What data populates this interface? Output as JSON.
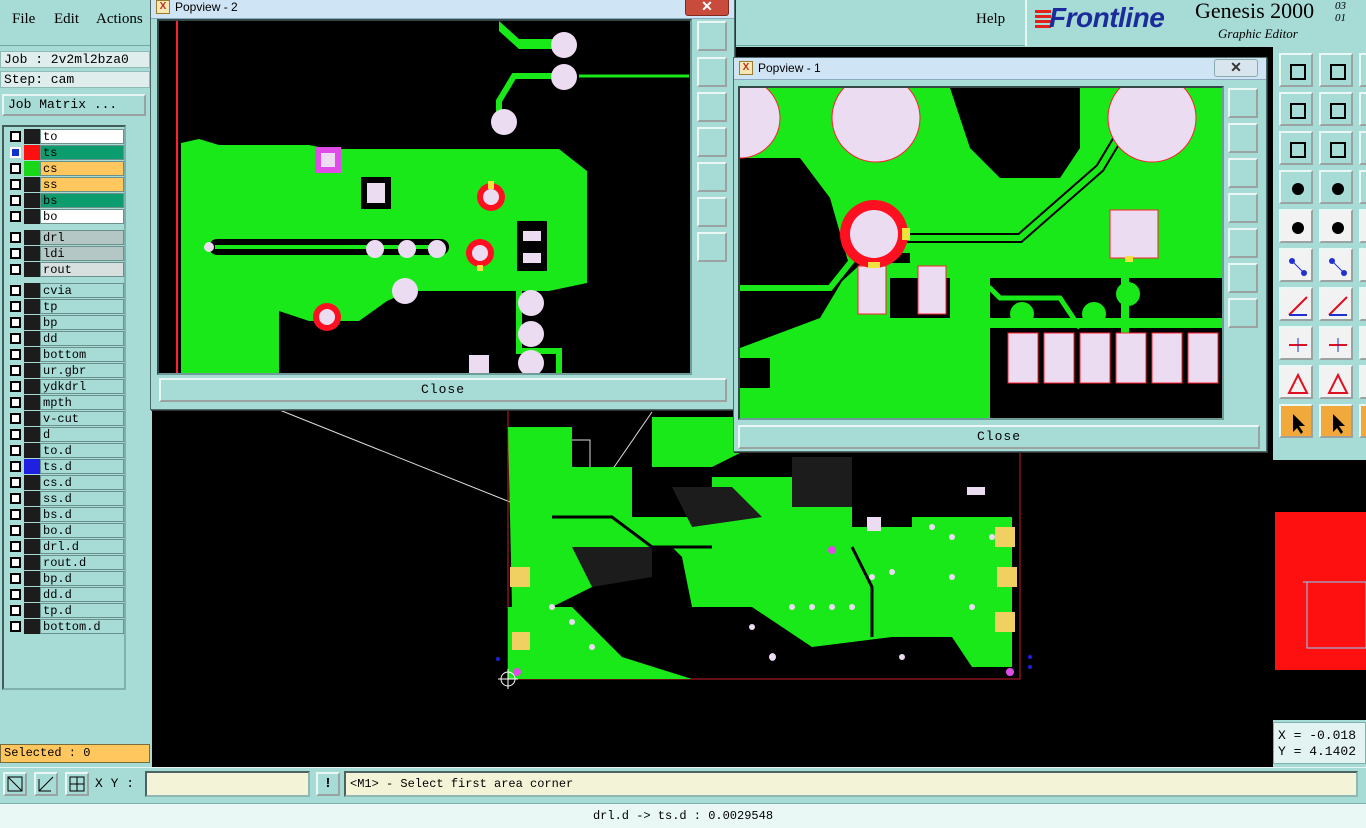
{
  "menu": {
    "file": "File",
    "edit": "Edit",
    "actions": "Actions",
    "help": "Help"
  },
  "logo": {
    "brand": "Frontline",
    "product": "Genesis 2000",
    "subtitle": "Graphic Editor",
    "version_line1": "03",
    "version_line2": "01"
  },
  "job": {
    "job_line": "Job : 2v2ml2bza0",
    "step_line": "Step: cam",
    "matrix_button": "Job Matrix ..."
  },
  "layers": [
    {
      "name": "to",
      "color": "#ffffff",
      "swatch": "#1c1c1c",
      "active": false
    },
    {
      "name": "ts",
      "color": "#0d9c6e",
      "swatch": "#ff1010",
      "active": true
    },
    {
      "name": "cs",
      "color": "#ffc75e",
      "swatch": "#19d619",
      "active": false
    },
    {
      "name": "ss",
      "color": "#ffc75e",
      "swatch": "#1c1c1c",
      "active": false
    },
    {
      "name": "bs",
      "color": "#0d9c6e",
      "swatch": "#1c1c1c",
      "active": false
    },
    {
      "name": "bo",
      "color": "#ffffff",
      "swatch": "#1c1c1c",
      "active": false
    },
    {
      "name": "drl",
      "color": "#b4c7c5",
      "swatch": "#1c1c1c",
      "active": false
    },
    {
      "name": "ldi",
      "color": "#b4c7c5",
      "swatch": "#1c1c1c",
      "active": false
    },
    {
      "name": "rout",
      "color": "#d8e0df",
      "swatch": "#1c1c1c",
      "active": false
    },
    {
      "name": "cvia",
      "color": "#a7dbd6",
      "swatch": "#1c1c1c",
      "active": false
    },
    {
      "name": "tp",
      "color": "#a7dbd6",
      "swatch": "#1c1c1c",
      "active": false
    },
    {
      "name": "bp",
      "color": "#a7dbd6",
      "swatch": "#1c1c1c",
      "active": false
    },
    {
      "name": "dd",
      "color": "#a7dbd6",
      "swatch": "#1c1c1c",
      "active": false
    },
    {
      "name": "bottom",
      "color": "#a7dbd6",
      "swatch": "#1c1c1c",
      "active": false
    },
    {
      "name": "ur.gbr",
      "color": "#a7dbd6",
      "swatch": "#1c1c1c",
      "active": false
    },
    {
      "name": "ydkdrl",
      "color": "#a7dbd6",
      "swatch": "#1c1c1c",
      "active": false
    },
    {
      "name": "mpth",
      "color": "#a7dbd6",
      "swatch": "#1c1c1c",
      "active": false
    },
    {
      "name": "v-cut",
      "color": "#a7dbd6",
      "swatch": "#1c1c1c",
      "active": false
    },
    {
      "name": "d",
      "color": "#a7dbd6",
      "swatch": "#1c1c1c",
      "active": false
    },
    {
      "name": "to.d",
      "color": "#a7dbd6",
      "swatch": "#1c1c1c",
      "active": false
    },
    {
      "name": "ts.d",
      "color": "#a7dbd6",
      "swatch": "#2020e0",
      "active": false
    },
    {
      "name": "cs.d",
      "color": "#a7dbd6",
      "swatch": "#1c1c1c",
      "active": false
    },
    {
      "name": "ss.d",
      "color": "#a7dbd6",
      "swatch": "#1c1c1c",
      "active": false
    },
    {
      "name": "bs.d",
      "color": "#a7dbd6",
      "swatch": "#1c1c1c",
      "active": false
    },
    {
      "name": "bo.d",
      "color": "#a7dbd6",
      "swatch": "#1c1c1c",
      "active": false
    },
    {
      "name": "drl.d",
      "color": "#a7dbd6",
      "swatch": "#1c1c1c",
      "active": false
    },
    {
      "name": "rout.d",
      "color": "#a7dbd6",
      "swatch": "#1c1c1c",
      "active": false
    },
    {
      "name": "bp.d",
      "color": "#a7dbd6",
      "swatch": "#1c1c1c",
      "active": false
    },
    {
      "name": "dd.d",
      "color": "#a7dbd6",
      "swatch": "#1c1c1c",
      "active": false
    },
    {
      "name": "tp.d",
      "color": "#a7dbd6",
      "swatch": "#1c1c1c",
      "active": false
    },
    {
      "name": "bottom.d",
      "color": "#a7dbd6",
      "swatch": "#1c1c1c",
      "active": false
    }
  ],
  "selected": "Selected : 0",
  "coords": {
    "x": "X = -0.018",
    "y": "Y = 4.1402"
  },
  "command": {
    "xy_label": "X Y :",
    "xy_value": "",
    "bang": "!",
    "prompt": "<M1> - Select first area corner"
  },
  "status": "drl.d -> ts.d : 0.0029548",
  "popview2": {
    "title": "Popview - 2",
    "close": "Close"
  },
  "popview1": {
    "title": "Popview - 1",
    "close": "Close"
  },
  "colors": {
    "panel": "#a7dbd6",
    "copper": "#19e819",
    "pad": "#ecdcf2",
    "annular": "#ff1020",
    "highlight": "#ffc75e"
  },
  "icons": [
    "zoom-fit-icon",
    "zoom-in-icon",
    "zoom-out-icon",
    "pan-left-icon",
    "pan-right-icon",
    "expand-icon",
    "fit-icon",
    "select-arrow-icon",
    "measure-icon",
    "snap-icon"
  ]
}
